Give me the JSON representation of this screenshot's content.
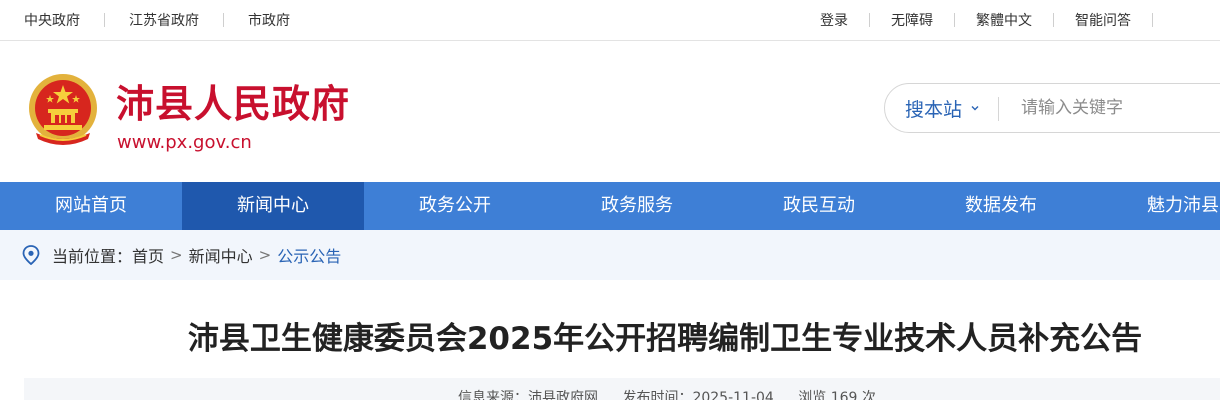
{
  "topbar": {
    "left_links": [
      "中央政府",
      "江苏省政府",
      "市政府"
    ],
    "right_links": [
      "登录",
      "无障碍",
      "繁體中文",
      "智能问答"
    ]
  },
  "header": {
    "title": "沛县人民政府",
    "url": "www.px.gov.cn",
    "brand_color": "#c8102e"
  },
  "search": {
    "scope_label": "搜本站",
    "placeholder": "请输入关键字"
  },
  "nav": {
    "items": [
      {
        "label": "网站首页"
      },
      {
        "label": "新闻中心"
      },
      {
        "label": "政务公开"
      },
      {
        "label": "政务服务"
      },
      {
        "label": "政民互动"
      },
      {
        "label": "数据发布"
      },
      {
        "label": "魅力沛县"
      }
    ],
    "active_label": "新闻中心",
    "bg_color": "#3e7fd6",
    "active_color": "#1f58ad"
  },
  "breadcrumb": {
    "label": "当前位置：",
    "items": [
      "首页",
      "新闻中心",
      "公示公告"
    ]
  },
  "article": {
    "title": "沛县卫生健康委员会2025年公开招聘编制卫生专业技术人员补充公告",
    "source": "信息来源：沛县政府网",
    "date": "发布时间：2025-11-04",
    "views": "浏览 169 次"
  },
  "icons": {
    "emblem": "national-emblem-icon",
    "location": "location-pin-icon",
    "dropdown": "chevron-down-icon"
  }
}
